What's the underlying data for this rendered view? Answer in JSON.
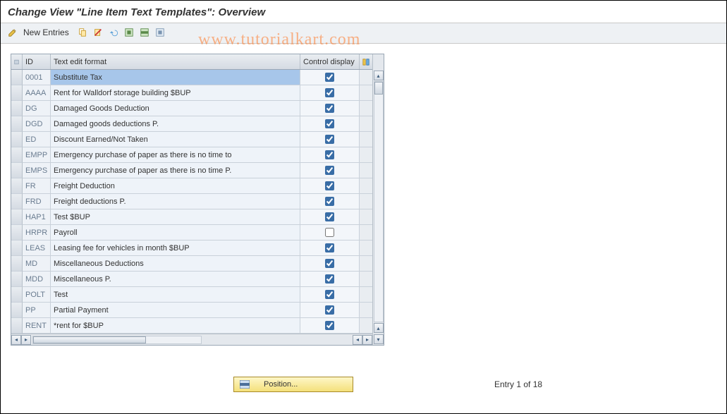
{
  "title": "Change View \"Line Item Text Templates\": Overview",
  "toolbar": {
    "new_entries": "New Entries"
  },
  "watermark": "www.tutorialkart.com",
  "headers": {
    "id": "ID",
    "text": "Text edit format",
    "control": "Control display"
  },
  "rows": [
    {
      "id": "0001",
      "text": "Substitute Tax",
      "control": true,
      "selected": true
    },
    {
      "id": "AAAA",
      "text": "Rent for Walldorf storage building $BUP",
      "control": true
    },
    {
      "id": "DG",
      "text": "Damaged Goods Deduction",
      "control": true
    },
    {
      "id": "DGD",
      "text": "Damaged goods deductions P.",
      "control": true
    },
    {
      "id": "ED",
      "text": "Discount Earned/Not Taken",
      "control": true
    },
    {
      "id": "EMPP",
      "text": "Emergency purchase of paper as there is no time to",
      "control": true
    },
    {
      "id": "EMPS",
      "text": "Emergency purchase of paper as there is no time P.",
      "control": true
    },
    {
      "id": "FR",
      "text": "Freight Deduction",
      "control": true
    },
    {
      "id": "FRD",
      "text": "Freight deductions P.",
      "control": true
    },
    {
      "id": "HAP1",
      "text": "Test $BUP",
      "control": true
    },
    {
      "id": "HRPR",
      "text": "Payroll",
      "control": false
    },
    {
      "id": "LEAS",
      "text": "Leasing fee for vehicles in month $BUP",
      "control": true
    },
    {
      "id": "MD",
      "text": "Miscellaneous Deductions",
      "control": true
    },
    {
      "id": "MDD",
      "text": "Miscellaneous P.",
      "control": true
    },
    {
      "id": "POLT",
      "text": "Test",
      "control": true
    },
    {
      "id": "PP",
      "text": "Partial Payment",
      "control": true
    },
    {
      "id": "RENT",
      "text": "*rent for $BUP",
      "control": true
    }
  ],
  "footer": {
    "position_label": "Position...",
    "entry_label": "Entry 1 of 18"
  }
}
